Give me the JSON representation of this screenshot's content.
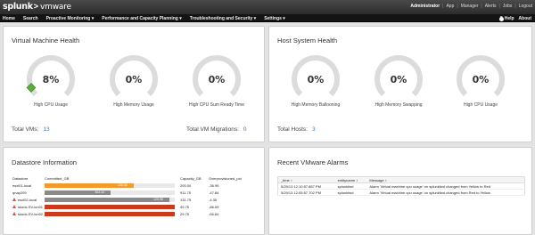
{
  "app": {
    "logo_primary": "splunk",
    "logo_chevron": ">",
    "logo_secondary": "vmware"
  },
  "header": {
    "user": "Administrator",
    "links": [
      "App",
      "Manager",
      "Alerts",
      "Jobs",
      "Logout"
    ]
  },
  "nav": {
    "items": [
      "Home",
      "Search",
      "Proactive Monitoring ▾",
      "Performance and Capacity Planning ▾",
      "Troubleshooting and Security ▾",
      "Settings ▾"
    ],
    "help": "Help",
    "about": "About"
  },
  "vm_health": {
    "title": "Virtual Machine Health",
    "gauges": [
      {
        "value_text": "8%",
        "fraction": 0.08,
        "label": "High CPU Usage",
        "alert": true
      },
      {
        "value_text": "0%",
        "fraction": 0,
        "label": "High Memory Usage",
        "alert": false
      },
      {
        "value_text": "0%",
        "fraction": 0,
        "label": "High CPU Sum Ready Time",
        "alert": false
      }
    ],
    "total_vms_label": "Total VMs:",
    "total_vms": "13",
    "total_migrations_label": "Total VM Migrations:",
    "total_migrations": "0"
  },
  "host_health": {
    "title": "Host System Health",
    "gauges": [
      {
        "value_text": "0%",
        "fraction": 0,
        "label": "High Memory Ballooning",
        "alert": false
      },
      {
        "value_text": "0%",
        "fraction": 0,
        "label": "High Memory Swapping",
        "alert": false
      },
      {
        "value_text": "0%",
        "fraction": 0,
        "label": "High CPU Usage",
        "alert": false
      }
    ],
    "total_hosts_label": "Total Hosts:",
    "total_hosts": "3"
  },
  "datastore": {
    "title": "Datastore Information",
    "columns": [
      "Datastore",
      "Committed_GB",
      "Capacity_GB",
      "Overprovisioned_pct"
    ],
    "rows": [
      {
        "name": "esxi01-local",
        "warn": false,
        "committed": "136.98",
        "fraction": 0.685,
        "capacity": "200.00",
        "pct": "-36.99",
        "color": "#f39a2b"
      },
      {
        "name": "qnap209",
        "warn": false,
        "committed": "464.44",
        "fraction": 0.51,
        "capacity": "911.75",
        "pct": "-47.84",
        "color": "#8a8a8a"
      },
      {
        "name": "esxi02-local",
        "warn": true,
        "committed": "125.98",
        "fraction": 0.96,
        "capacity": "131.75",
        "pct": "-4.35",
        "color": "#8a8a8a"
      },
      {
        "name": "skunk-SV-lun01",
        "warn": true,
        "committed": "",
        "fraction": 1.0,
        "capacity": "49.75",
        "pct": "-86.09",
        "color": "#cc3a1d"
      },
      {
        "name": "skunk-SV-lun02",
        "warn": true,
        "committed": "",
        "fraction": 1.0,
        "capacity": "29.75",
        "pct": "-66.84",
        "color": "#cc3a1d"
      }
    ]
  },
  "alarms": {
    "title": "Recent VMware Alarms",
    "columns": [
      "_time ↕",
      "entityname ↕",
      "Message ↕"
    ],
    "rows": [
      {
        "time": "5/29/13 12:10:57.887 PM",
        "entity": "splunkfwd",
        "message": "Alarm 'Virtual machine cpu usage' on splunkfwd changed from Yellow to Red"
      },
      {
        "time": "5/29/13 12:05:57.702 PM",
        "entity": "splunkfwd",
        "message": "Alarm 'Virtual machine cpu usage' on splunkfwd changed from Red to Yellow"
      }
    ]
  },
  "colors": {
    "gauge_track": "#dcdcdc",
    "gauge_ok": "#5cac3c",
    "link_blue": "#3b74b8"
  }
}
